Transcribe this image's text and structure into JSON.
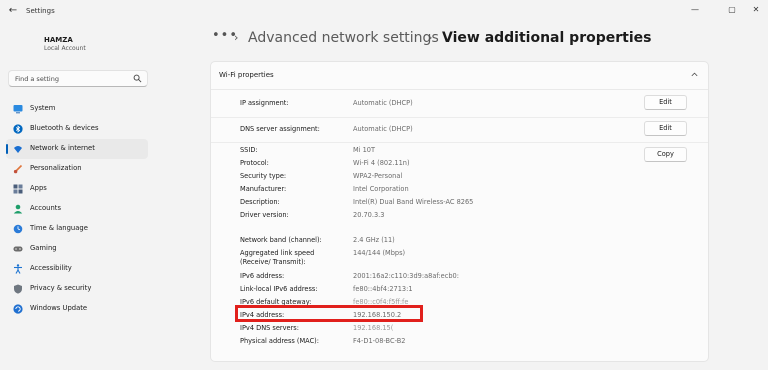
{
  "app": {
    "title": "Settings"
  },
  "window": {
    "back_glyph": "←",
    "minimize_glyph": "—",
    "maximize_glyph": "▢",
    "close_glyph": "✕"
  },
  "profile": {
    "name": "HAMZA",
    "account_type": "Local Account"
  },
  "search": {
    "placeholder": "Find a setting",
    "icon": "search-icon"
  },
  "nav": {
    "items": [
      {
        "label": "System",
        "icon": "monitor-icon",
        "color": "#0078d4"
      },
      {
        "label": "Bluetooth & devices",
        "icon": "bluetooth-icon",
        "color": "#0067c0"
      },
      {
        "label": "Network & internet",
        "icon": "wifi-icon",
        "color": "#1a6fd1",
        "active": true
      },
      {
        "label": "Personalization",
        "icon": "brush-icon",
        "color": "#e0763c"
      },
      {
        "label": "Apps",
        "icon": "apps-icon",
        "color": "#4a5d7a"
      },
      {
        "label": "Accounts",
        "icon": "person-icon",
        "color": "#1e9e6a"
      },
      {
        "label": "Time & language",
        "icon": "globe-clock-icon",
        "color": "#2a7bd8"
      },
      {
        "label": "Gaming",
        "icon": "gamepad-icon",
        "color": "#6b6b6b"
      },
      {
        "label": "Accessibility",
        "icon": "accessibility-icon",
        "color": "#1d74d1"
      },
      {
        "label": "Privacy & security",
        "icon": "shield-icon",
        "color": "#6f7780"
      },
      {
        "label": "Windows Update",
        "icon": "update-icon",
        "color": "#1f6fd0"
      }
    ]
  },
  "breadcrumb": {
    "dots": "•••",
    "separator": "›",
    "parent": "Advanced network settings",
    "current": "View additional properties"
  },
  "card": {
    "title": "Wi-Fi properties",
    "ip_assignment": {
      "label": "IP assignment:",
      "value": "Automatic (DHCP)",
      "button": "Edit"
    },
    "dns_assignment": {
      "label": "DNS server assignment:",
      "value": "Automatic (DHCP)",
      "button": "Edit"
    },
    "copy_button": "Copy",
    "properties_group1": [
      {
        "label": "SSID:",
        "value": "Mi 10T"
      },
      {
        "label": "Protocol:",
        "value": "Wi-Fi 4 (802.11n)"
      },
      {
        "label": "Security type:",
        "value": "WPA2-Personal"
      },
      {
        "label": "Manufacturer:",
        "value": "Intel Corporation"
      },
      {
        "label": "Description:",
        "value": "Intel(R) Dual Band Wireless-AC 8265"
      },
      {
        "label": "Driver version:",
        "value": "20.70.3.3"
      }
    ],
    "properties_group2": [
      {
        "label": "Network band (channel):",
        "value": "2.4 GHz (11)"
      },
      {
        "label": "Aggregated link speed (Receive/ Transmit):",
        "value": "144/144 (Mbps)"
      },
      {
        "label": "IPv6 address:",
        "value": "2001:16a2:c110:3d9:a8af:ecb0:"
      },
      {
        "label": "Link-local IPv6 address:",
        "value": "fe80::4bf4:2713:1"
      },
      {
        "label": "IPv6 default gateway:",
        "value": "fe80::c0f4:f5ff:fe"
      },
      {
        "label": "IPv4 address:",
        "value": "192.168.150.2"
      },
      {
        "label": "IPv4 DNS servers:",
        "value": "192.168.15("
      },
      {
        "label": "Physical address (MAC):",
        "value": "F4-D1-08-BC-B2"
      }
    ]
  },
  "colors": {
    "accent": "#005fb8",
    "highlight": "#e1201c"
  }
}
